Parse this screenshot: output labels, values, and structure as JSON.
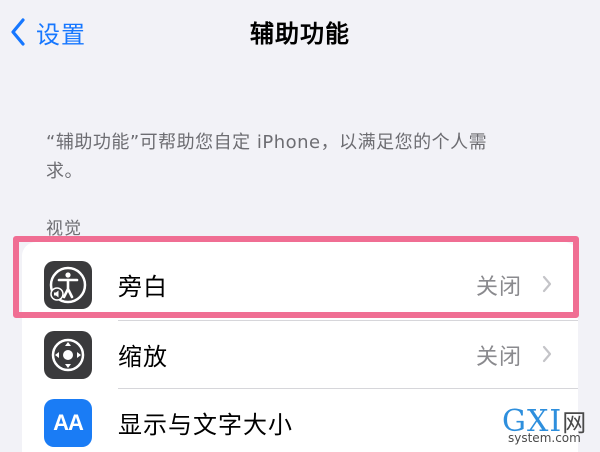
{
  "nav": {
    "back_label": "设置",
    "title": "辅助功能"
  },
  "description": "“辅助功能”可帮助您自定 iPhone，以满足您的个人需求。",
  "section": {
    "label": "视觉"
  },
  "items": [
    {
      "label": "旁白",
      "value": "关闭",
      "icon": "voiceover-icon",
      "highlighted": true
    },
    {
      "label": "缩放",
      "value": "关闭",
      "icon": "zoom-icon"
    },
    {
      "label": "显示与文字大小",
      "icon": "display-text-size-icon",
      "icon_text": "AA"
    }
  ],
  "colors": {
    "accent": "#1677ff",
    "highlight_border": "#f06e93",
    "dark_icon_bg": "#3a3a3c",
    "blue_icon_bg": "#1a7cf5",
    "page_bg": "#f2f2f7"
  },
  "watermark": {
    "logo": "GXI",
    "logo_suffix": "网",
    "domain": "system.com"
  }
}
